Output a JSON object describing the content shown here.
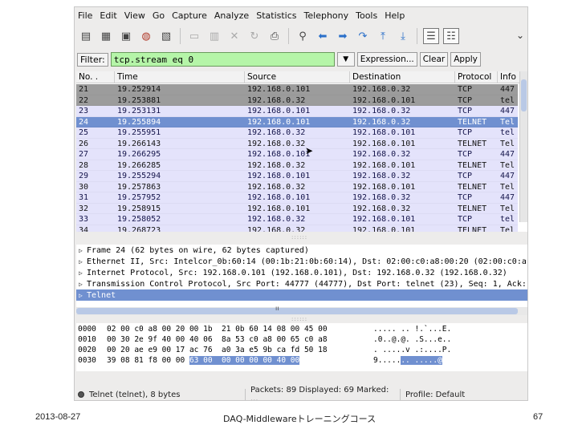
{
  "menu": [
    "File",
    "Edit",
    "View",
    "Go",
    "Capture",
    "Analyze",
    "Statistics",
    "Telephony",
    "Tools",
    "Help"
  ],
  "toolbar": {
    "icons": [
      "interface-list-icon",
      "capture-options-icon",
      "start-capture-icon",
      "stop-capture-icon",
      "restart-capture-icon",
      "open-file-icon",
      "save-file-icon",
      "close-file-icon",
      "reload-icon",
      "print-icon",
      "find-packet-icon",
      "go-back-icon",
      "go-forward-icon",
      "go-to-packet-icon",
      "go-first-icon",
      "go-last-icon",
      "colorize-icon",
      "autoscroll-icon"
    ],
    "more": "⌄"
  },
  "filter": {
    "label": "Filter:",
    "value": "tcp.stream eq 0",
    "expression_label": "Expression...",
    "clear_label": "Clear",
    "apply_label": "Apply"
  },
  "packet_list": {
    "columns": [
      "No. .",
      "Time",
      "Source",
      "Destination",
      "Protocol",
      "Info"
    ],
    "rows": [
      {
        "no": "21",
        "time": "19.252914",
        "src": "192.168.0.101",
        "dst": "192.168.0.32",
        "proto": "TCP",
        "info": "447",
        "style": "tcp-g"
      },
      {
        "no": "22",
        "time": "19.253881",
        "src": "192.168.0.32",
        "dst": "192.168.0.101",
        "proto": "TCP",
        "info": "tel",
        "style": "tcp-g"
      },
      {
        "no": "23",
        "time": "19.253131",
        "src": "192.168.0.101",
        "dst": "192.168.0.32",
        "proto": "TCP",
        "info": "447",
        "style": "tcp"
      },
      {
        "no": "24",
        "time": "19.255894",
        "src": "192.168.0.101",
        "dst": "192.168.0.32",
        "proto": "TELNET",
        "info": "Tel",
        "style": "selected"
      },
      {
        "no": "25",
        "time": "19.255951",
        "src": "192.168.0.32",
        "dst": "192.168.0.101",
        "proto": "TCP",
        "info": "tel",
        "style": "tcp"
      },
      {
        "no": "26",
        "time": "19.266143",
        "src": "192.168.0.32",
        "dst": "192.168.0.101",
        "proto": "TELNET",
        "info": "Tel",
        "style": "telnet"
      },
      {
        "no": "27",
        "time": "19.266295",
        "src": "192.168.0.101",
        "dst": "192.168.0.32",
        "proto": "TCP",
        "info": "447",
        "style": "tcp"
      },
      {
        "no": "28",
        "time": "19.266285",
        "src": "192.168.0.32",
        "dst": "192.168.0.101",
        "proto": "TELNET",
        "info": "Tel",
        "style": "telnet"
      },
      {
        "no": "29",
        "time": "19.255294",
        "src": "192.168.0.101",
        "dst": "192.168.0.32",
        "proto": "TCP",
        "info": "447",
        "style": "tcp"
      },
      {
        "no": "30",
        "time": "19.257863",
        "src": "192.168.0.32",
        "dst": "192.168.0.101",
        "proto": "TELNET",
        "info": "Tel",
        "style": "telnet"
      },
      {
        "no": "31",
        "time": "19.257952",
        "src": "192.168.0.101",
        "dst": "192.168.0.32",
        "proto": "TCP",
        "info": "447",
        "style": "tcp"
      },
      {
        "no": "32",
        "time": "19.258915",
        "src": "192.168.0.101",
        "dst": "192.168.0.32",
        "proto": "TELNET",
        "info": "Tel",
        "style": "telnet"
      },
      {
        "no": "33",
        "time": "19.258052",
        "src": "192.168.0.32",
        "dst": "192.168.0.101",
        "proto": "TCP",
        "info": "tel",
        "style": "tcp"
      },
      {
        "no": "34",
        "time": "19.268723",
        "src": "192.168.0.32",
        "dst": "192.168.0.101",
        "proto": "TELNET",
        "info": "Tel",
        "style": "telnet"
      }
    ]
  },
  "splitter_grip": "::::::",
  "details": [
    {
      "text": "Frame 24 (62 bytes on wire, 62 bytes captured)",
      "selected": false
    },
    {
      "text": "Ethernet II, Src: Intelcor_0b:60:14 (00:1b:21:0b:60:14), Dst: 02:00:c0:a8:00:20 (02:00:c0:a",
      "selected": false
    },
    {
      "text": "Internet Protocol, Src: 192.168.0.101 (192.168.0.101), Dst: 192.168.0.32 (192.168.0.32)",
      "selected": false
    },
    {
      "text": "Transmission Control Protocol, Src Port: 44777 (44777), Dst Port: telnet (23), Seq: 1, Ack:",
      "selected": false
    },
    {
      "text": "Telnet",
      "selected": true
    }
  ],
  "details_scroll_mark": "ıı",
  "bytes": [
    {
      "off": "0000",
      "hex": "02 00 c0 a8 00 20 00 1b  21 0b 60 14 08 00 45 00",
      "ascii": "..... .. !.`...E."
    },
    {
      "off": "0010",
      "hex": "00 30 2e 9f 40 00 40 06  8a 53 c0 a8 00 65 c0 a8",
      "ascii": ".0..@.@. .S...e.."
    },
    {
      "off": "0020",
      "hex": "00 20 ae e9 00 17 ac 76  a0 3a e5 9b ca fd 50 18",
      "ascii": ". .....v .:....P."
    },
    {
      "off": "0030",
      "hex_plain": "39 08 81 f8 00 00 ",
      "hex_hl": "63 00  00 00 00 00 40 00",
      "ascii_plain": "9.....",
      "ascii_hl": ".. .....@"
    }
  ],
  "status": {
    "field": "Telnet (telnet), 8 bytes",
    "packets": "Packets: 89 Displayed: 69 Marked: ...",
    "profile": "Profile: Default"
  },
  "slide": {
    "date": "2013-08-27",
    "course": "DAQ-Middlewareトレーニングコース",
    "page": "67"
  }
}
